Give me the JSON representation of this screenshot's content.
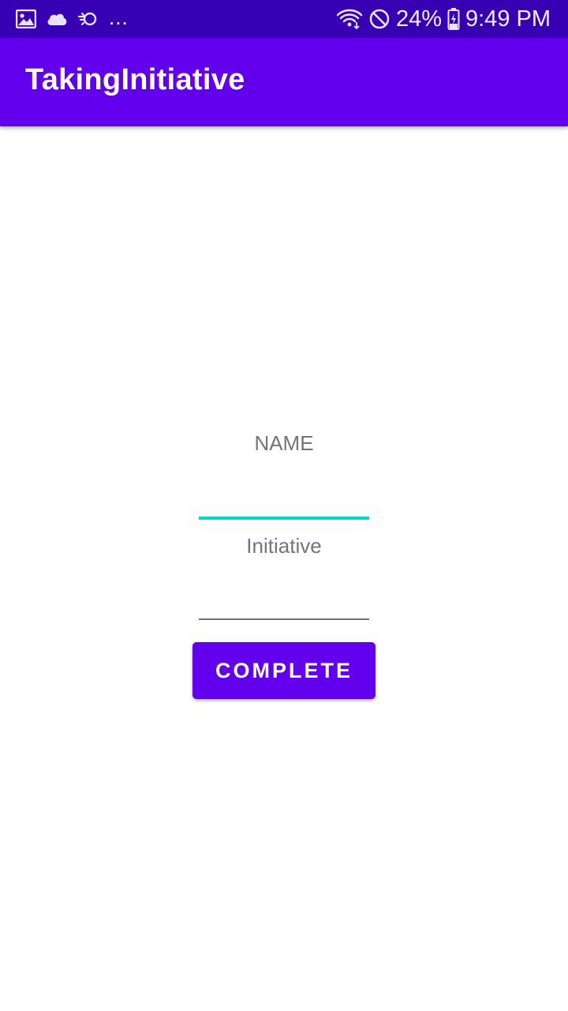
{
  "status_bar": {
    "left_icons": [
      "image-icon",
      "cloud-icon",
      "sync-icon"
    ],
    "overflow": "...",
    "right_icons": [
      "wifi-icon",
      "do-not-disturb-icon",
      "battery-charging-icon"
    ],
    "battery_percent": "24%",
    "time": "9:49 PM",
    "colors": {
      "background": "#3700b3",
      "foreground": "#ffffff"
    }
  },
  "app_bar": {
    "title": "TakingInitiative",
    "color": "#6200ee"
  },
  "form": {
    "name_label": "NAME",
    "name_value": "",
    "initiative_label": "Initiative",
    "initiative_value": "",
    "complete_button_label": "COMPLETE",
    "focus_accent_color": "#03dac5"
  }
}
